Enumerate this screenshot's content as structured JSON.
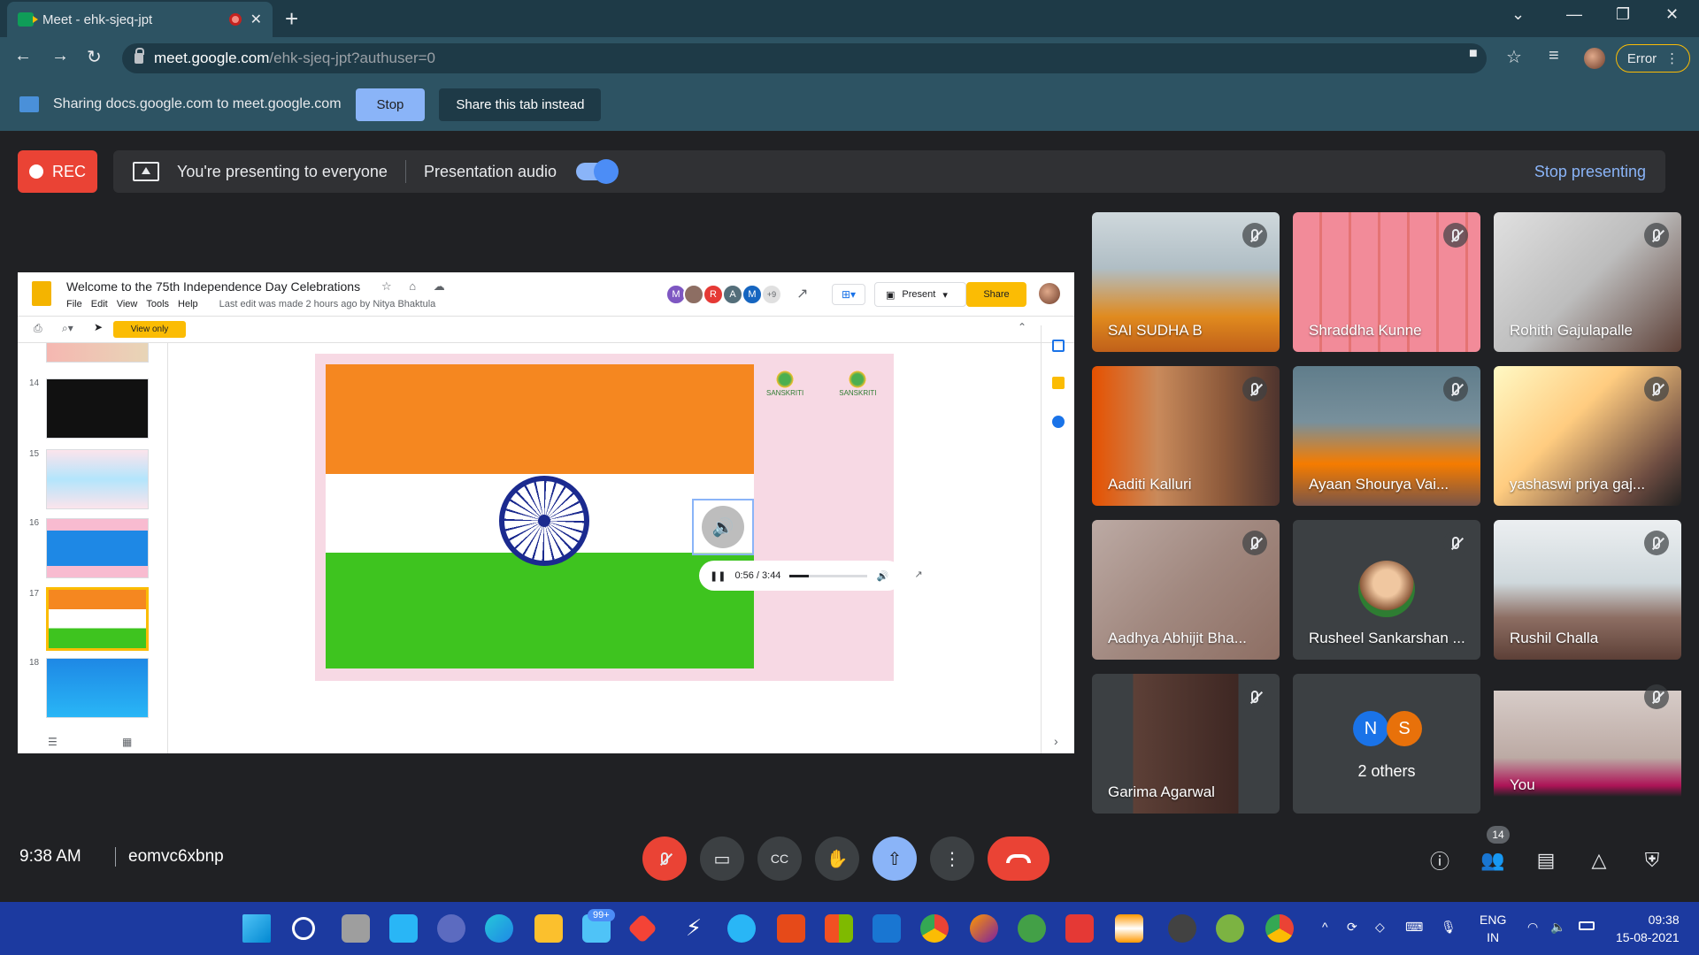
{
  "browser": {
    "tab_title": "Meet - ehk-sjeq-jpt",
    "url_host": "meet.google.com",
    "url_path": "/ehk-sjeq-jpt?authuser=0",
    "error_label": "Error"
  },
  "sharing_bar": {
    "message": "Sharing docs.google.com to meet.google.com",
    "stop_label": "Stop",
    "share_tab_label": "Share this tab instead"
  },
  "presenting": {
    "rec_label": "REC",
    "status": "You're presenting to everyone",
    "audio_label": "Presentation audio",
    "stop_label": "Stop presenting"
  },
  "slides": {
    "title": "Welcome to the 75th Independence Day Celebrations",
    "menus": [
      "File",
      "Edit",
      "View",
      "Tools",
      "Help"
    ],
    "last_edit": "Last edit was made 2 hours ago by Nitya Bhaktula",
    "collaborators": [
      "M",
      "",
      "R",
      "A",
      "M",
      "+9"
    ],
    "present_label": "Present",
    "share_label": "Share",
    "view_only_label": "View only",
    "thumbnail_numbers": [
      "14",
      "15",
      "16",
      "17",
      "18"
    ],
    "audio_time": "0:56 / 3:44",
    "audio_progress": 0.25,
    "logo_text_1": "SANSKRITI",
    "logo_text_2": "SANSKRITI"
  },
  "participants": [
    {
      "name": "SAI SUDHA B"
    },
    {
      "name": "Shraddha Kunne"
    },
    {
      "name": "Rohith Gajulapalle"
    },
    {
      "name": "Aaditi Kalluri"
    },
    {
      "name": "Ayaan Shourya Vai..."
    },
    {
      "name": "yashaswi priya gaj..."
    },
    {
      "name": "Aadhya Abhijit Bha..."
    },
    {
      "name": "Rusheel Sankarshan ..."
    },
    {
      "name": "Rushil Challa"
    },
    {
      "name": "Garima Agarwal"
    },
    {
      "name": "2 others",
      "avatars": [
        "N",
        "S"
      ]
    },
    {
      "name": "You"
    }
  ],
  "bottom_bar": {
    "time": "9:38 AM",
    "meeting_code": "eomvc6xbnp",
    "participant_count": "14"
  },
  "taskbar": {
    "mail_badge": "99+",
    "lang_1": "ENG",
    "lang_2": "IN",
    "clock_time": "09:38",
    "clock_date": "15-08-2021"
  },
  "colors": {
    "meet_bg": "#202124",
    "chrome_dark": "#1e3a47",
    "chrome_light": "#2d5363",
    "accent_blue": "#8ab4f8",
    "rec_red": "#ea4335"
  }
}
